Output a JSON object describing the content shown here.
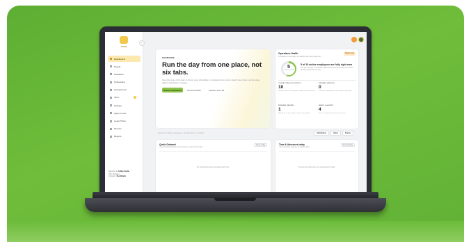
{
  "sidebar": {
    "logo_text": "SOON",
    "collapse_glyph": "‹",
    "items": [
      {
        "label": "Dashboard",
        "active": true
      },
      {
        "label": "People"
      },
      {
        "label": "Workflows"
      },
      {
        "label": "Onboarding"
      },
      {
        "label": "Assessments"
      },
      {
        "label": "Inbox",
        "badge": true
      },
      {
        "label": "Settings"
      },
      {
        "label": "Apps & more"
      },
      {
        "label": "Leave Policy"
      },
      {
        "label": "Finance"
      },
      {
        "label": "Reports"
      }
    ],
    "footer": {
      "line1_prefix": "Signed in as",
      "line1_name": "Ashley Fowler",
      "line2": "Role: Manager",
      "line3_prefix": "Company:",
      "line3_name": "SoonStudio"
    }
  },
  "hero": {
    "tag": "OVERVIEW",
    "title": "Run the day from one place, not six tabs.",
    "subtitle": "Keep the pulse of the team in check, clear scheduling & compliance items and a clearly view of key, not the noise, without switching to manager.",
    "button": "Refresh dashboard",
    "date": "24/11/Sep/2025",
    "time": "Updated 11:17:09"
  },
  "panel": {
    "title": "Operations Health",
    "subtitle": "A snapshot of coverage, compliance, and roster alignment.",
    "badge": "Needs care",
    "ring_value": "5",
    "ring_label": "CLEAR OF TOTAL",
    "headline": "5 of 10 active employees are fully right now",
    "description": "Use the coverage, 4 compliance gaps and 3 items an pending inbox items. All clean before the next sync.",
    "stats": [
      {
        "label": "CLEAR TODAY ACCOUNTS",
        "value": "10",
        "desc": "Contracts that are missing or needing a prompt review."
      },
      {
        "label": "EXPIRED CREDITS",
        "value": "0",
        "desc": "Contracts marked with a hard expiry in the policy."
      },
      {
        "label": "PENDING REVIEW",
        "value": "1",
        "desc": "Waiting for a clear update today in this pipeline."
      },
      {
        "label": "INBOX & ALERTS",
        "value": "4",
        "desc": "Items to respond to before the next sync."
      }
    ]
  },
  "search": {
    "placeholder": "Search for tasks, employees, specific items, or teams"
  },
  "filters": [
    "Attendance",
    "Inbox",
    "Teams"
  ],
  "cards": [
    {
      "title": "Quick Onboard",
      "subtitle": "Latest onboarding tasks across the team, sorted by due date.",
      "button": "Create today",
      "empty": "No onboarding tasks are waiting right now."
    },
    {
      "title": "Time & Absences today",
      "subtitle": "Time overviews, clock-ins, and other status.",
      "button": "View all today",
      "empty": "No approved absences are scheduled for today."
    }
  ],
  "colors": {
    "background_green": "#6fbd3a",
    "accent_green": "#8bc34a",
    "active_nav": "#fbe9b0",
    "badge_orange": "#fde7c4"
  },
  "icons": {
    "nav": "square-outline-icon",
    "collapse": "chevron-left-icon",
    "nav_chevron": "chevron-right-icon"
  }
}
